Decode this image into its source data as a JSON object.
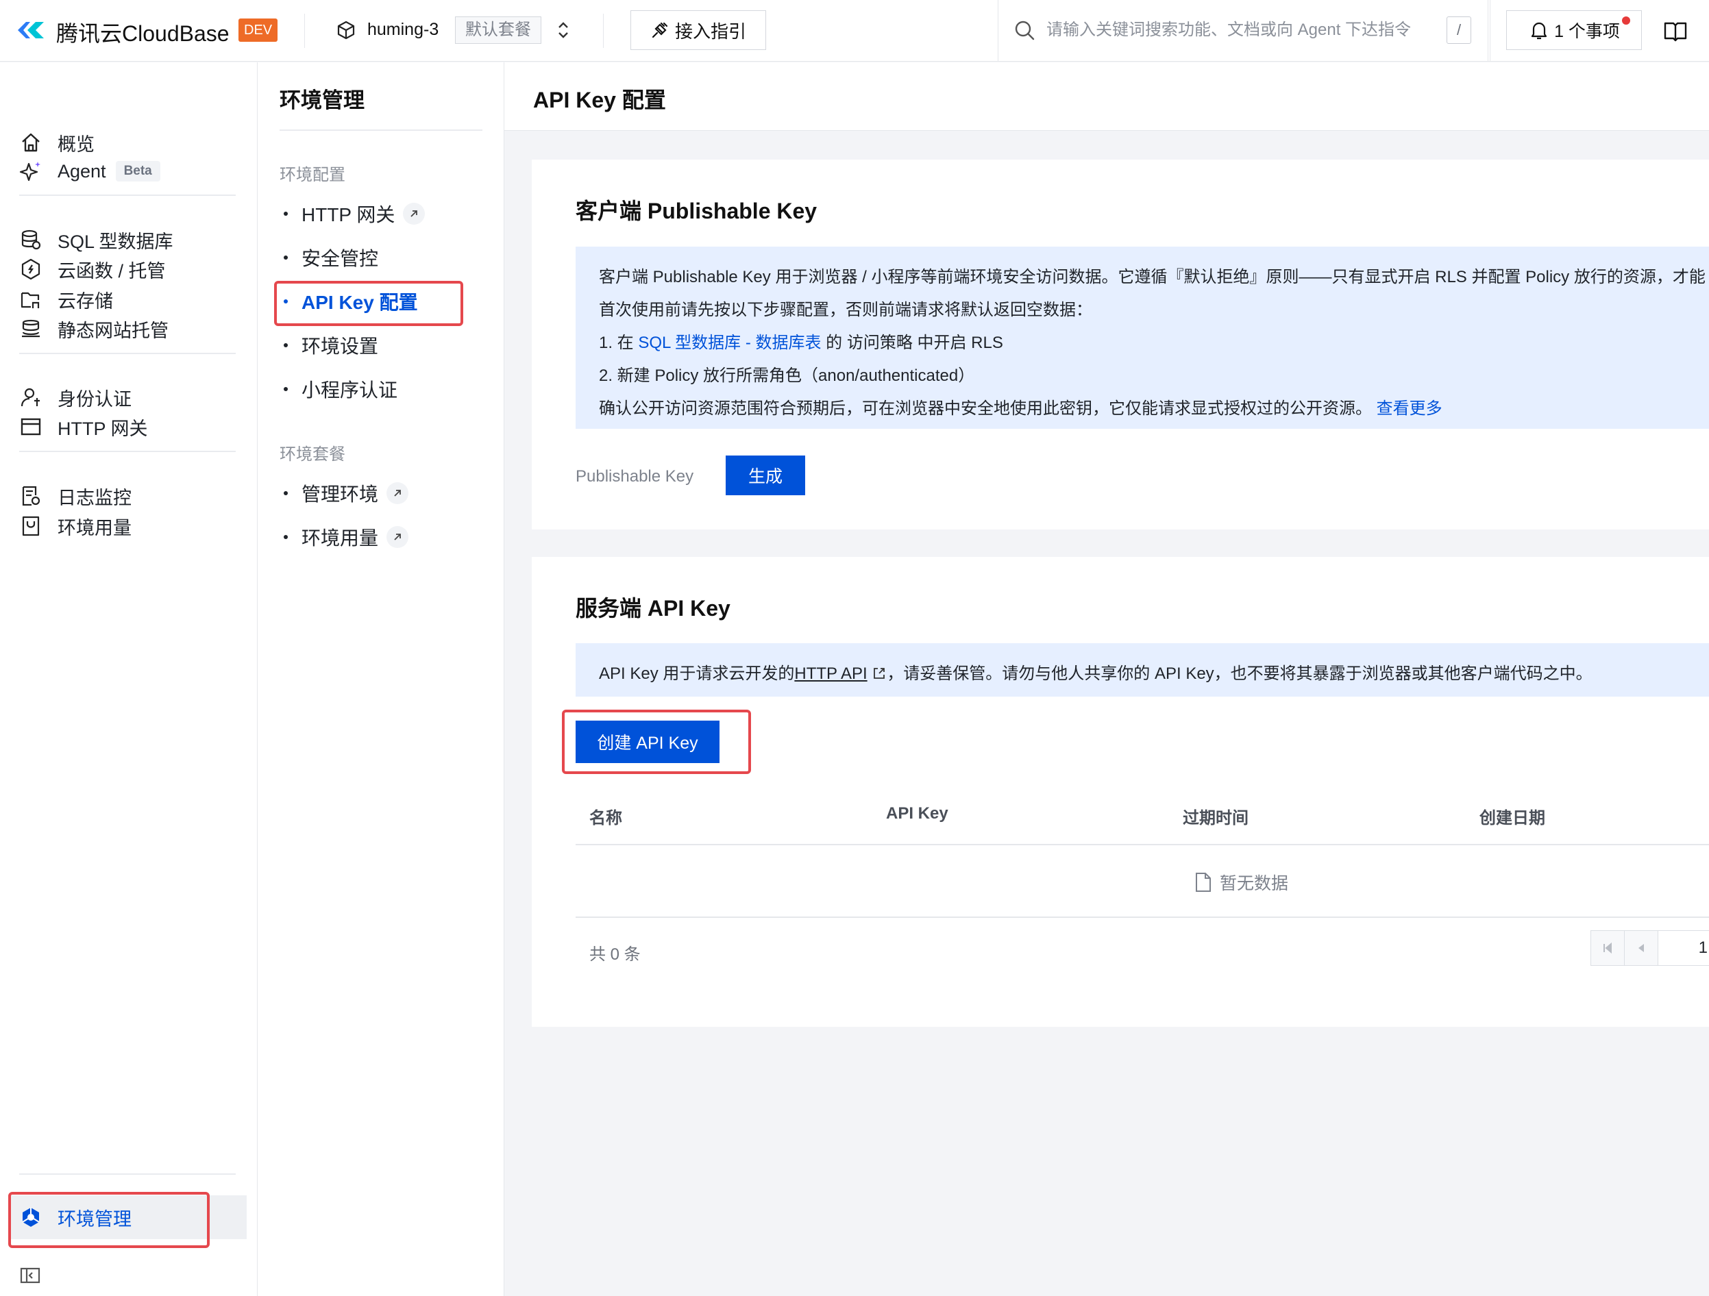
{
  "topbar": {
    "brand": "腾讯云CloudBase",
    "env_badge": "DEV",
    "env_name": "huming-3",
    "env_plan": "默认套餐",
    "guide_button": "接入指引",
    "search_placeholder": "请输入关键词搜索功能、文档或向 Agent 下达指令",
    "search_shortcut": "/",
    "notifications": "1 个事项",
    "icons": [
      "cloudbase-logo-icon",
      "cube-icon",
      "chevron-up-down-icon",
      "plug-icon",
      "search-icon",
      "bell-icon",
      "book-icon"
    ]
  },
  "sidebar": {
    "items": [
      {
        "label": "概览",
        "icon": "home-icon"
      },
      {
        "label": "Agent",
        "icon": "sparkle-icon",
        "badge": "Beta"
      },
      {
        "label": "SQL 型数据库",
        "icon": "database-icon"
      },
      {
        "label": "云函数 / 托管",
        "icon": "function-icon"
      },
      {
        "label": "云存储",
        "icon": "storage-icon"
      },
      {
        "label": "静态网站托管",
        "icon": "website-icon"
      },
      {
        "label": "身份认证",
        "icon": "user-icon"
      },
      {
        "label": "HTTP 网关",
        "icon": "gateway-icon"
      },
      {
        "label": "日志监控",
        "icon": "log-icon"
      },
      {
        "label": "环境用量",
        "icon": "usage-icon"
      }
    ],
    "active_item": {
      "label": "环境管理",
      "icon": "env-settings-icon"
    },
    "accent": "#0052d9"
  },
  "subnav": {
    "title": "环境管理",
    "groups": [
      {
        "label": "环境配置",
        "items": [
          {
            "label": "HTTP 网关",
            "external": true
          },
          {
            "label": "安全管控",
            "external": false
          },
          {
            "label": "API Key 配置",
            "external": false,
            "active": true
          },
          {
            "label": "环境设置",
            "external": false
          },
          {
            "label": "小程序认证",
            "external": false
          }
        ]
      },
      {
        "label": "环境套餐",
        "items": [
          {
            "label": "管理环境",
            "external": true
          },
          {
            "label": "环境用量",
            "external": true
          }
        ]
      }
    ]
  },
  "main": {
    "title": "API Key 配置",
    "publishable": {
      "title": "客户端 Publishable Key",
      "line1": "客户端 Publishable Key 用于浏览器 / 小程序等前端环境安全访问数据。它遵循『默认拒绝』原则——只有显式开启 RLS 并配置 Policy 放行的资源，才能",
      "line2": "首次使用前请先按以下步骤配置，否则前端请求将默认返回空数据：",
      "step1_prefix": "1. 在 ",
      "step1_link": "SQL 型数据库 - 数据库表",
      "step1_suffix": " 的 访问策略 中开启 RLS",
      "step2": "2. 新建 Policy 放行所需角色（anon/authenticated）",
      "line5": "确认公开访问资源范围符合预期后，可在浏览器中安全地使用此密钥，它仅能请求显式授权过的公开资源。",
      "more_link": "查看更多",
      "field_label": "Publishable Key",
      "generate_button": "生成"
    },
    "server": {
      "title": "服务端 API Key",
      "info_prefix": "API Key 用于请求云开发的",
      "info_link": "HTTP API",
      "info_suffix": "，请妥善保管。请勿与他人共享你的 API Key，也不要将其暴露于浏览器或其他客户端代码之中。",
      "create_button": "创建 API Key",
      "columns": [
        "名称",
        "API Key",
        "过期时间",
        "创建日期"
      ],
      "empty_text": "暂无数据",
      "total": "共 0 条",
      "page": "1"
    }
  }
}
